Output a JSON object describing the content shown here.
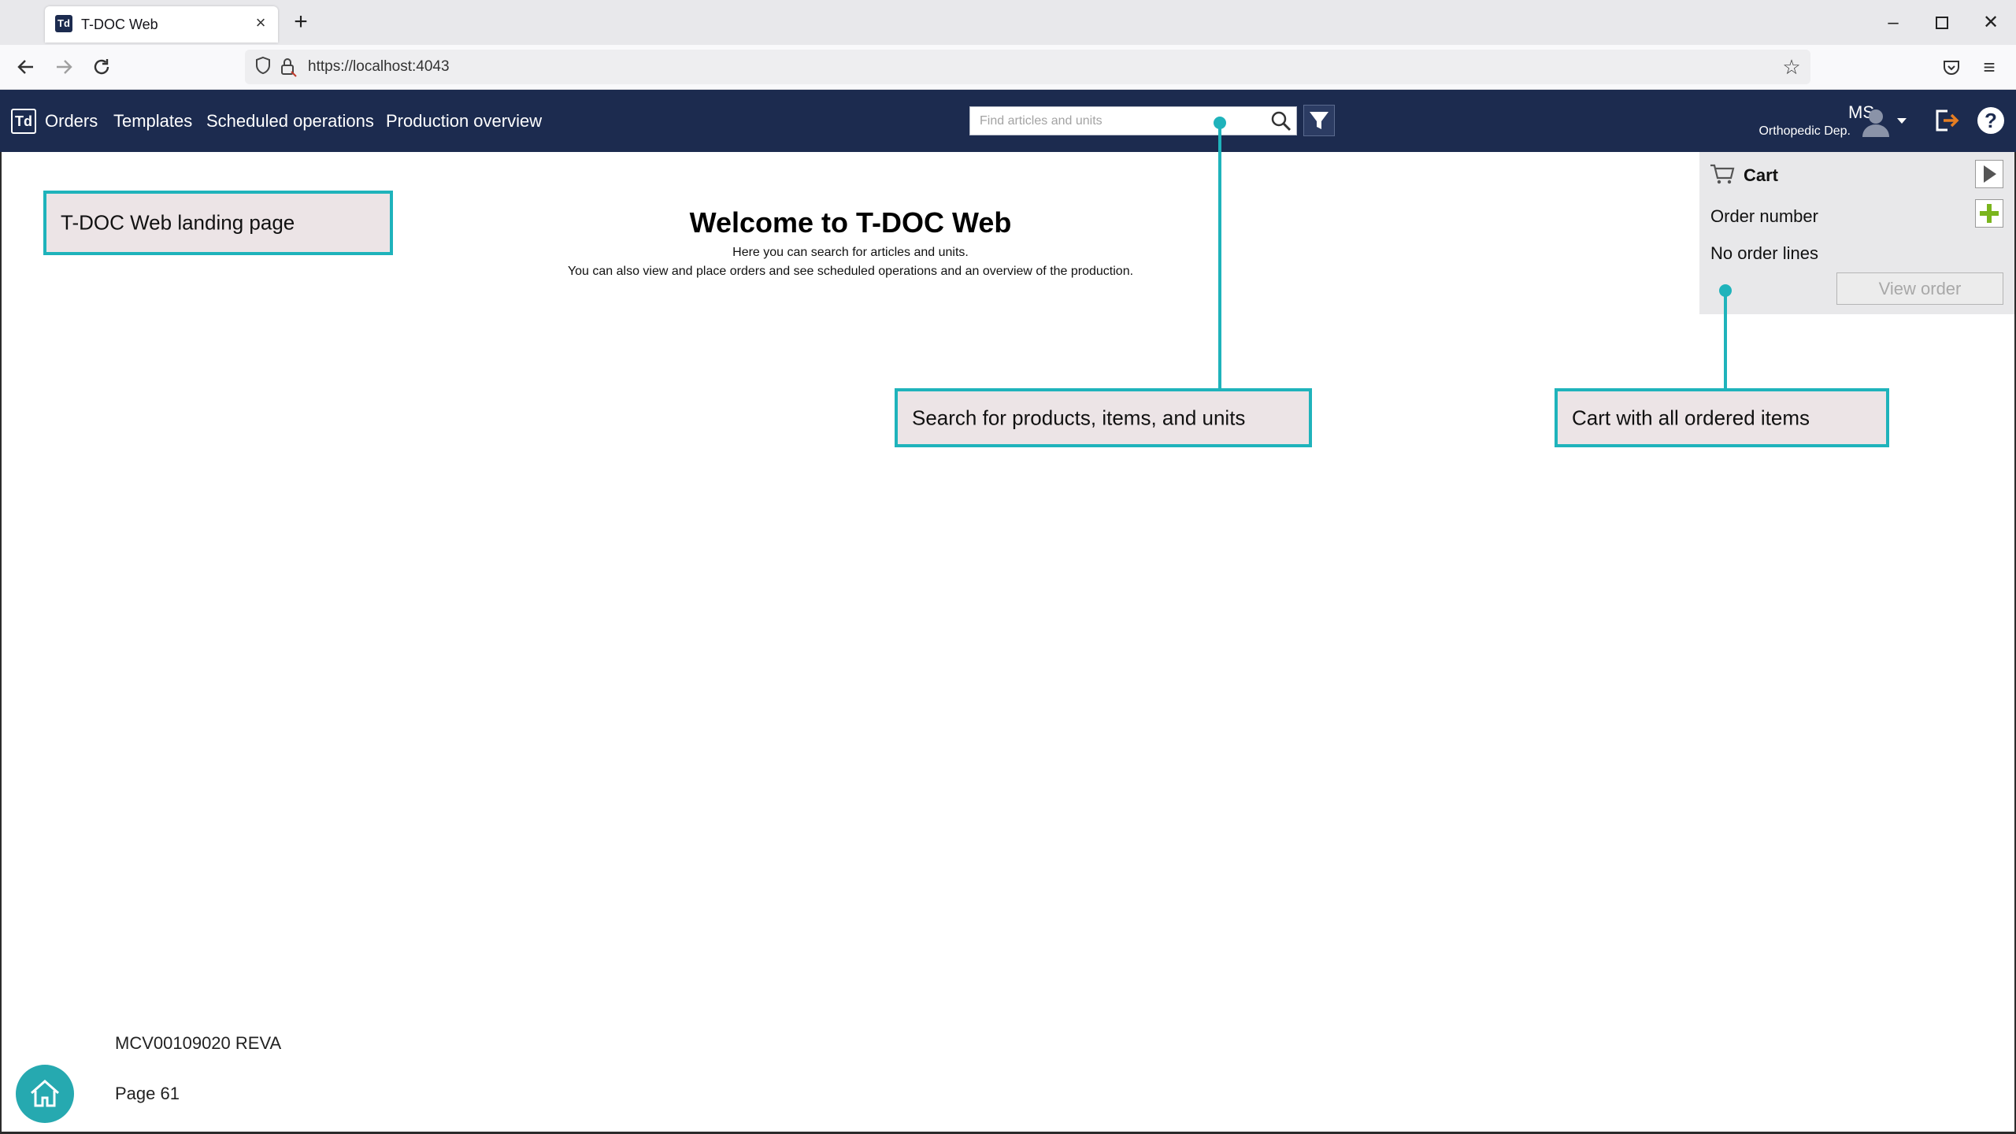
{
  "browser": {
    "tab_title": "T-DOC Web",
    "tab_favicon": "Td",
    "new_tab": "+",
    "url": "https://localhost:4043"
  },
  "app": {
    "logo": "Td",
    "nav": [
      "Orders",
      "Templates",
      "Scheduled operations",
      "Production overview"
    ],
    "search_placeholder": "Find articles and units",
    "user_initials": "MS",
    "user_department": "Orthopedic Dep.",
    "help": "?"
  },
  "main": {
    "title": "Welcome to T-DOC Web",
    "line1": "Here you can search for articles and units.",
    "line2": "You can also view and place orders and see scheduled operations and an overview of the production."
  },
  "cart": {
    "title": "Cart",
    "order_number_label": "Order number",
    "empty_text": "No order lines",
    "view_order_label": "View order"
  },
  "callouts": {
    "landing": "T-DOC Web landing page",
    "search": "Search for products, items, and units",
    "cart": "Cart with all ordered items"
  },
  "footer": {
    "doc_id": "MCV00109020 REVA",
    "page": "Page 61"
  },
  "icons": {
    "tab": "t-doc-favicon",
    "back": "back-arrow-icon",
    "forward": "forward-arrow-icon",
    "reload": "reload-icon",
    "search": "magnifier-icon",
    "filter": "funnel-icon",
    "cart": "shopping-cart-icon",
    "home": "house-icon"
  },
  "colors": {
    "header_bg": "#1c2b4f",
    "callout_border": "#1fb3bb",
    "callout_bg": "#ece4e6",
    "cart_bg": "#e8e8ea",
    "add_green": "#7ab51d",
    "home_button": "#26a9b0"
  }
}
